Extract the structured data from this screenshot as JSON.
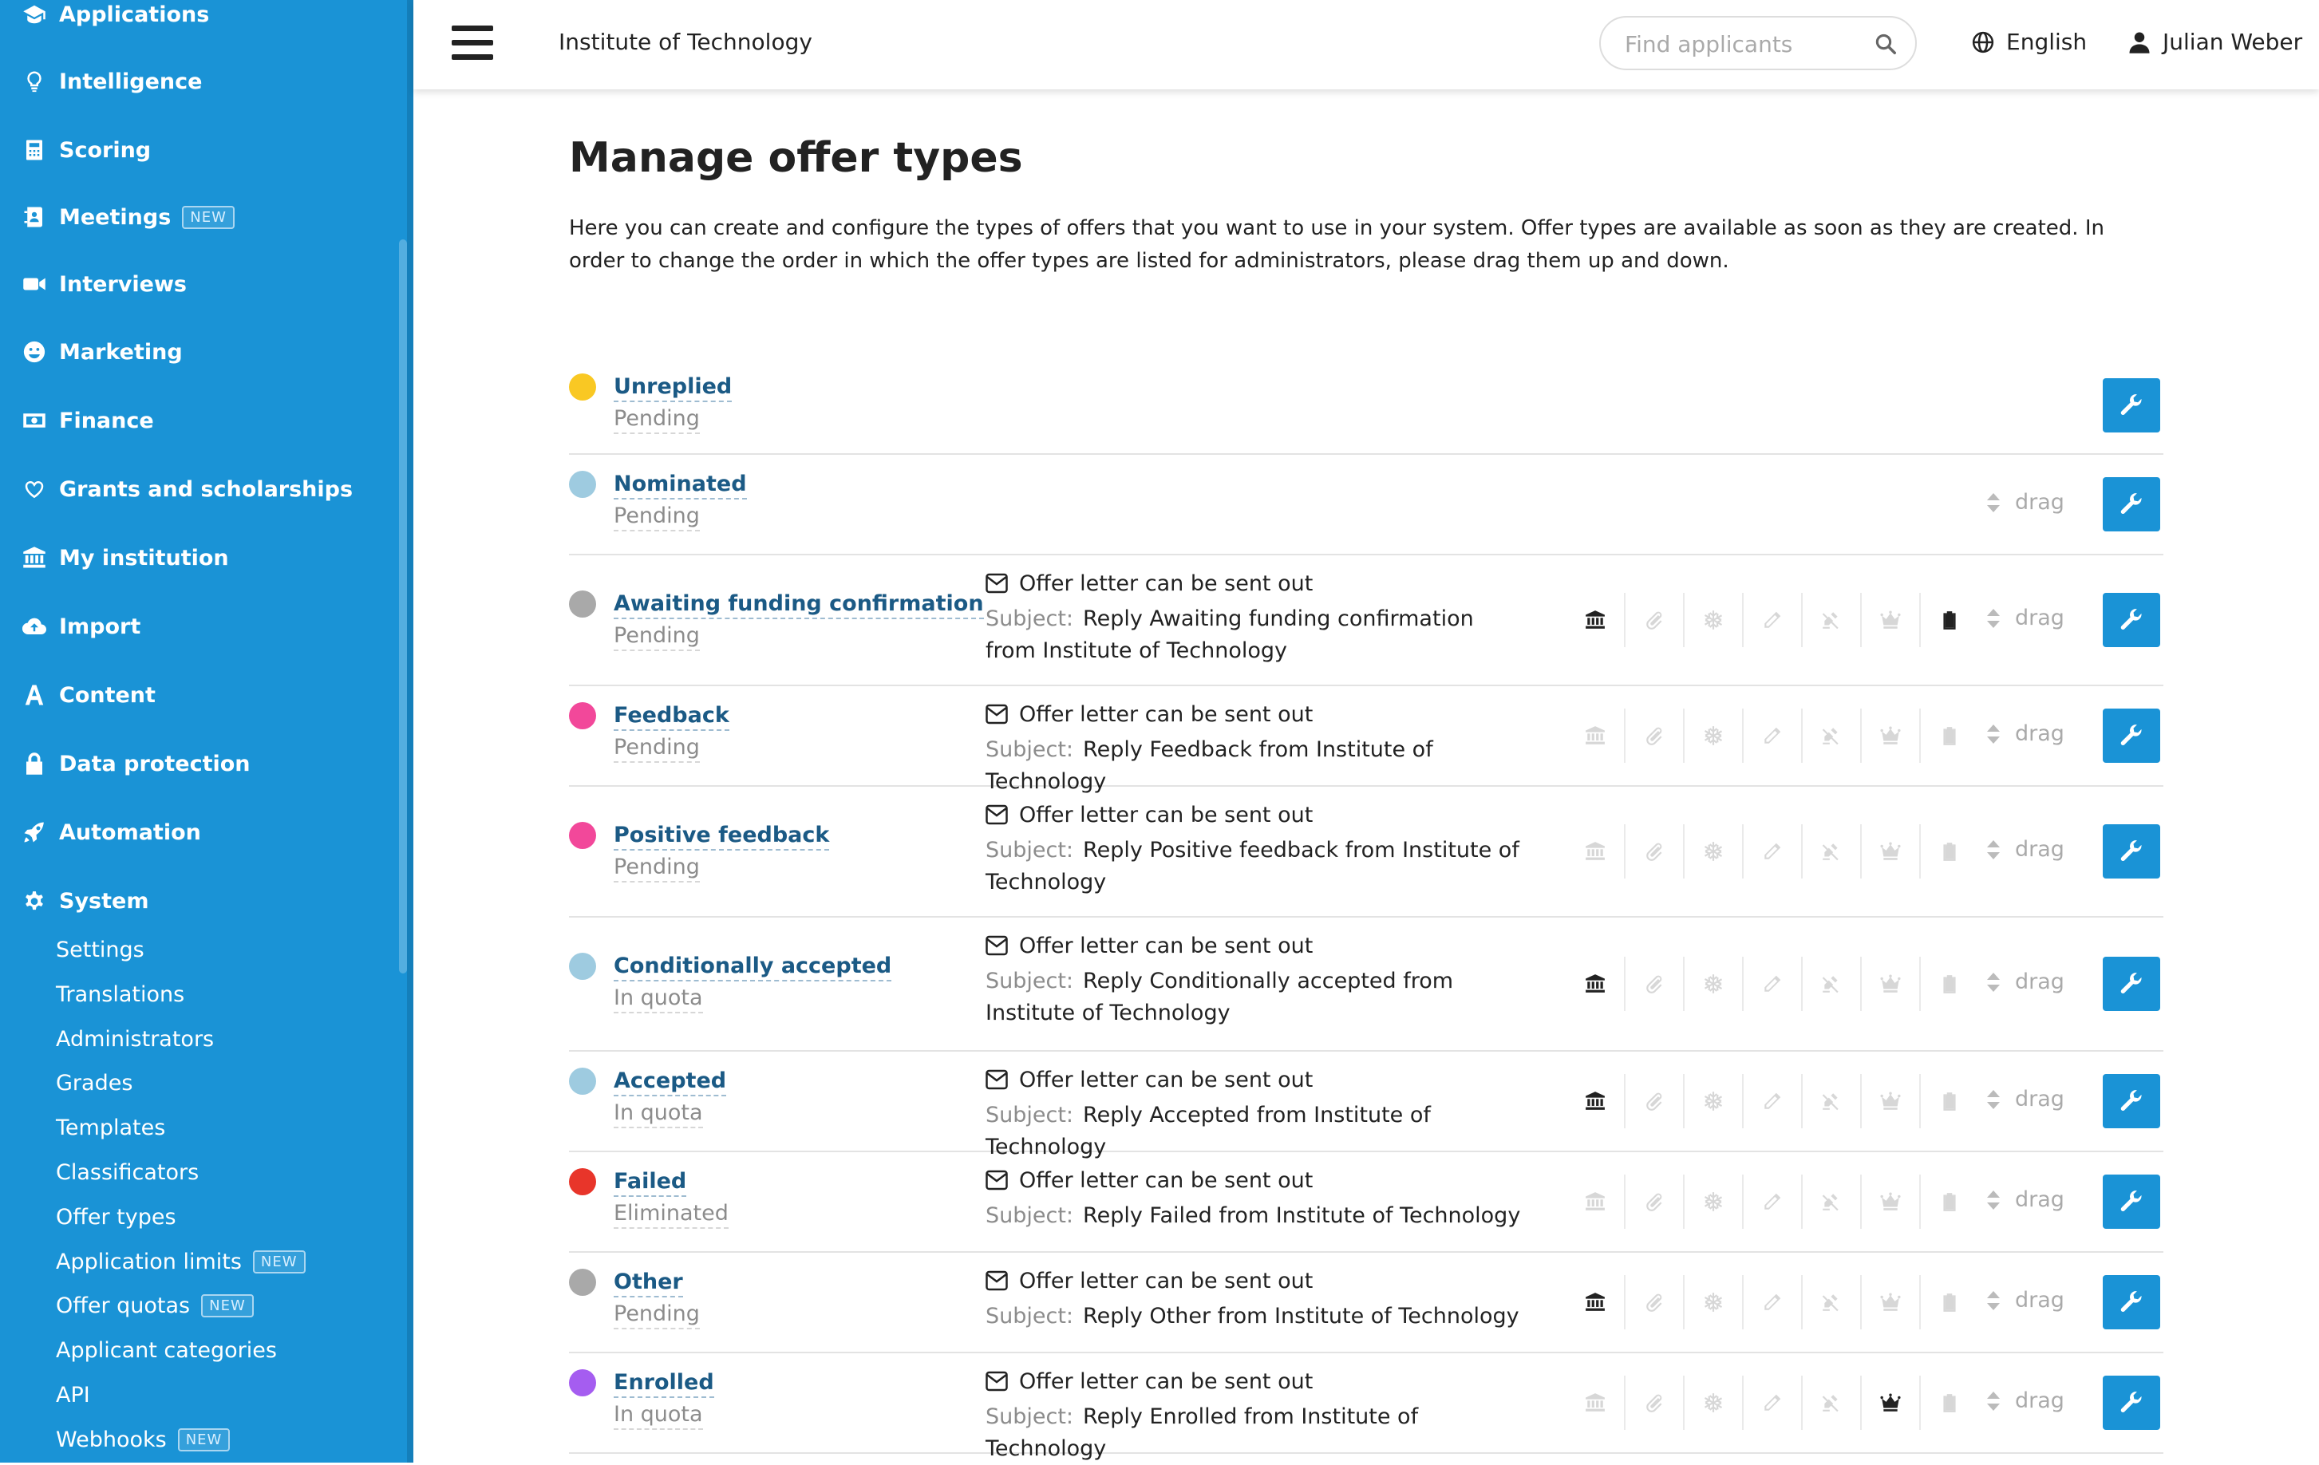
{
  "sidebar": {
    "nav": [
      {
        "label": "Applications",
        "icon": "graduation-cap-icon"
      },
      {
        "label": "Intelligence",
        "icon": "lightbulb-icon"
      },
      {
        "label": "Scoring",
        "icon": "calculator-icon"
      },
      {
        "label": "Meetings",
        "icon": "contact-book-icon",
        "badge": "NEW"
      },
      {
        "label": "Interviews",
        "icon": "video-camera-icon"
      },
      {
        "label": "Marketing",
        "icon": "smiley-icon"
      },
      {
        "label": "Finance",
        "icon": "money-bill-icon"
      },
      {
        "label": "Grants and scholarships",
        "icon": "heart-icon"
      },
      {
        "label": "My institution",
        "icon": "institution-icon"
      },
      {
        "label": "Import",
        "icon": "cloud-upload-icon"
      },
      {
        "label": "Content",
        "icon": "font-a-icon"
      },
      {
        "label": "Data protection",
        "icon": "lock-icon"
      },
      {
        "label": "Automation",
        "icon": "rocket-icon"
      },
      {
        "label": "System",
        "icon": "cog-icon"
      }
    ],
    "sub": [
      {
        "label": "Settings"
      },
      {
        "label": "Translations"
      },
      {
        "label": "Administrators"
      },
      {
        "label": "Grades"
      },
      {
        "label": "Templates"
      },
      {
        "label": "Classificators"
      },
      {
        "label": "Offer types"
      },
      {
        "label": "Application limits",
        "badge": "NEW"
      },
      {
        "label": "Offer quotas",
        "badge": "NEW"
      },
      {
        "label": "Applicant categories"
      },
      {
        "label": "API"
      },
      {
        "label": "Webhooks",
        "badge": "NEW"
      }
    ]
  },
  "header": {
    "title": "Institute of Technology",
    "search_placeholder": "Find applicants",
    "language": "English",
    "user": "Julian Weber"
  },
  "main": {
    "title": "Manage offer types",
    "description": "Here you can create and configure the types of offers that you want to use in your system. Offer types are available as soon as they are created. In order to change the order in which the offer types are listed for administrators, please drag them up and down."
  },
  "labels": {
    "letter": "Offer letter can be sent out",
    "subject": "Subject:",
    "drag": "drag"
  },
  "icon_names": [
    "institution-icon",
    "paperclip-icon",
    "snowflake-icon",
    "pencil-icon",
    "signature-icon",
    "crown-icon",
    "clipboard-icon"
  ],
  "offer_types": [
    {
      "name": "Unreplied",
      "status": "Pending",
      "color": "#f9c823",
      "subject": null,
      "draggable": false,
      "icons_on": []
    },
    {
      "name": "Nominated",
      "status": "Pending",
      "color": "#9ecbe0",
      "subject": null,
      "draggable": true,
      "icons_on": []
    },
    {
      "name": "Awaiting funding confirmation",
      "status": "Pending",
      "color": "#a9a9a9",
      "subject": "Reply Awaiting funding confirmation from Institute of Technology",
      "draggable": true,
      "icons_on": [
        0,
        6
      ]
    },
    {
      "name": "Feedback",
      "status": "Pending",
      "color": "#f2489a",
      "subject": "Reply Feedback from Institute of Technology",
      "draggable": true,
      "icons_on": []
    },
    {
      "name": "Positive feedback",
      "status": "Pending",
      "color": "#f2489a",
      "subject": "Reply Positive feedback from Institute of Technology",
      "draggable": true,
      "icons_on": []
    },
    {
      "name": "Conditionally accepted",
      "status": "In quota",
      "color": "#9ecbe0",
      "subject": "Reply Conditionally accepted from Institute of Technology",
      "draggable": true,
      "icons_on": [
        0
      ]
    },
    {
      "name": "Accepted",
      "status": "In quota",
      "color": "#9ecbe0",
      "subject": "Reply Accepted from Institute of Technology",
      "draggable": true,
      "icons_on": [
        0
      ]
    },
    {
      "name": "Failed",
      "status": "Eliminated",
      "color": "#e8352a",
      "subject": "Reply Failed from Institute of Technology",
      "draggable": true,
      "icons_on": []
    },
    {
      "name": "Other",
      "status": "Pending",
      "color": "#a9a9a9",
      "subject": "Reply Other from Institute of Technology",
      "draggable": true,
      "icons_on": [
        0
      ]
    },
    {
      "name": "Enrolled",
      "status": "In quota",
      "color": "#a55df0",
      "subject": "Reply Enrolled from Institute of Technology",
      "draggable": true,
      "icons_on": [
        5
      ]
    }
  ]
}
